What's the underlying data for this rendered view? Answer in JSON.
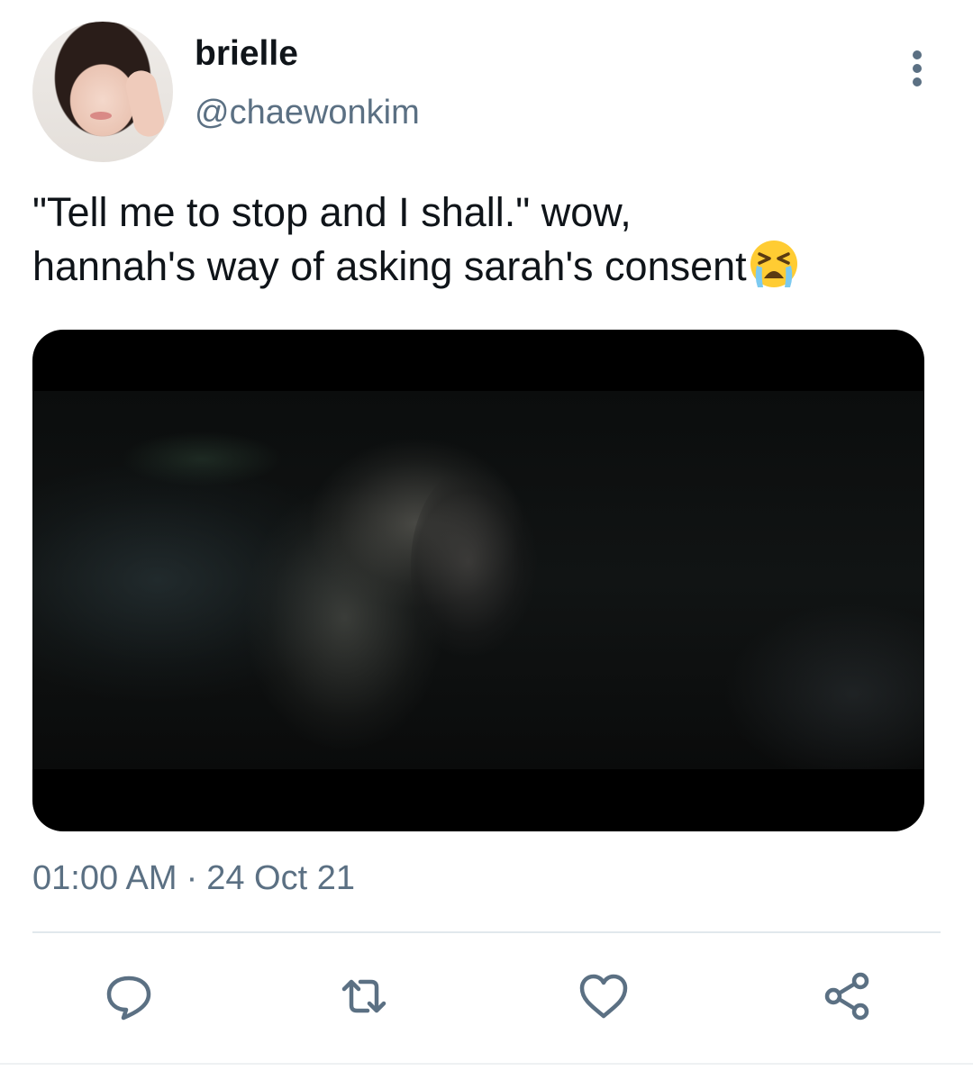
{
  "author": {
    "name": "brielle",
    "handle": "@chaewonkim"
  },
  "tweet": {
    "text_line1": "\"Tell me to stop and I shall.\" wow,",
    "text_line2": "hannah's way of asking sarah's consent",
    "emoji": "crying-face-emoji"
  },
  "meta": {
    "time": "01:00 AM",
    "separator": "·",
    "date": "24 Oct 21"
  },
  "colors": {
    "text": "#0f1419",
    "secondary": "#5b7083",
    "divider": "#e1e8ed"
  },
  "icons": {
    "reply": "comment-icon",
    "retweet": "retweet-icon",
    "like": "heart-icon",
    "share": "share-icon",
    "more": "more-vertical-icon"
  }
}
